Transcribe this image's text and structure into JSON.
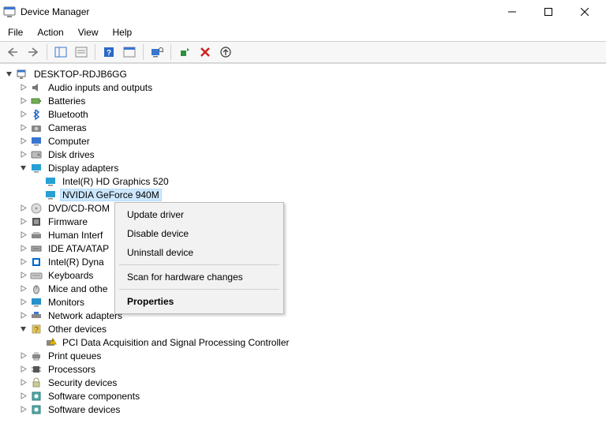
{
  "window": {
    "title": "Device Manager"
  },
  "menubar": {
    "file": "File",
    "action": "Action",
    "view": "View",
    "help": "Help"
  },
  "tree": {
    "root": "DESKTOP-RDJB6GG",
    "items": [
      {
        "label": "Audio inputs and outputs",
        "icon": "audio"
      },
      {
        "label": "Batteries",
        "icon": "battery"
      },
      {
        "label": "Bluetooth",
        "icon": "bluetooth"
      },
      {
        "label": "Cameras",
        "icon": "camera"
      },
      {
        "label": "Computer",
        "icon": "computer"
      },
      {
        "label": "Disk drives",
        "icon": "disk"
      },
      {
        "label": "Display adapters",
        "icon": "display",
        "expanded": true,
        "children": [
          {
            "label": "Intel(R) HD Graphics 520",
            "icon": "display"
          },
          {
            "label": "NVIDIA GeForce 940M",
            "icon": "display",
            "selected": true
          }
        ]
      },
      {
        "label": "DVD/CD-ROM",
        "icon": "dvd",
        "truncated": true
      },
      {
        "label": "Firmware",
        "icon": "firmware"
      },
      {
        "label": "Human Interf",
        "icon": "hid",
        "truncated": true
      },
      {
        "label": "IDE ATA/ATAP",
        "icon": "ide",
        "truncated": true
      },
      {
        "label": "Intel(R) Dyna",
        "icon": "intel",
        "truncated": true
      },
      {
        "label": "Keyboards",
        "icon": "keyboard"
      },
      {
        "label": "Mice and othe",
        "icon": "mouse",
        "truncated": true
      },
      {
        "label": "Monitors",
        "icon": "monitor"
      },
      {
        "label": "Network adapters",
        "icon": "network"
      },
      {
        "label": "Other devices",
        "icon": "other",
        "expanded": true,
        "children": [
          {
            "label": "PCI Data Acquisition and Signal Processing Controller",
            "icon": "warn"
          }
        ]
      },
      {
        "label": "Print queues",
        "icon": "printer"
      },
      {
        "label": "Processors",
        "icon": "cpu"
      },
      {
        "label": "Security devices",
        "icon": "security"
      },
      {
        "label": "Software components",
        "icon": "software"
      },
      {
        "label": "Software devices",
        "icon": "software",
        "cutoff": true
      }
    ]
  },
  "context_menu": {
    "update": "Update driver",
    "disable": "Disable device",
    "uninstall": "Uninstall device",
    "scan": "Scan for hardware changes",
    "properties": "Properties"
  }
}
